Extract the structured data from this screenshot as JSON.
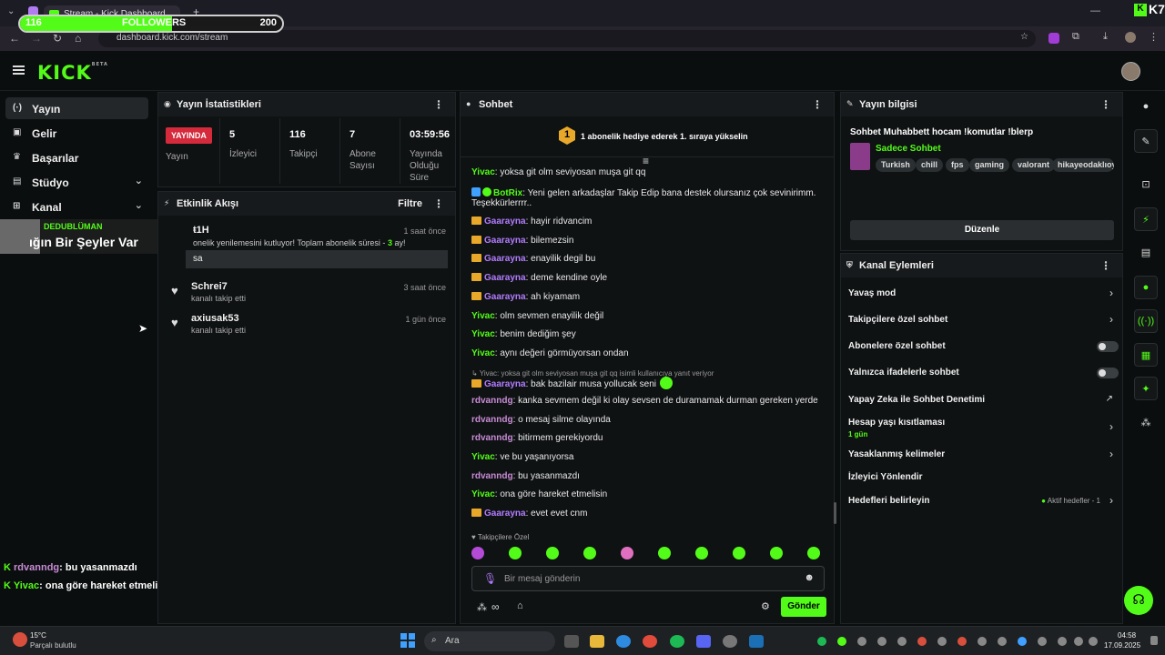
{
  "browser": {
    "tab_title": "Stream - Kick Dashboard",
    "url": "dashboard.kick.com/stream",
    "add_tab": "+",
    "extension_label": "K7"
  },
  "overlay": {
    "followers_current": "116",
    "followers_label": "FOLLOWERS",
    "followers_goal": "200",
    "followers_progress": 0.58,
    "chat": [
      {
        "user": "rdvanndg",
        "text": ": bu yasanmazdı"
      },
      {
        "user": "Yivac",
        "text": ": ona göre hareket etmelisin"
      }
    ],
    "popup_user": "DEDUBLÜMAN",
    "popup_text": "ığın Bir Şeyler Var"
  },
  "header": {
    "logo": "KICK",
    "logo_sup": "BETA"
  },
  "sidebar": {
    "items": [
      {
        "label": "Yayın",
        "icon": "(·)"
      },
      {
        "label": "Gelir",
        "icon": "▣"
      },
      {
        "label": "Başarılar",
        "icon": "♛"
      },
      {
        "label": "Stüdyo",
        "icon": "▤"
      },
      {
        "label": "Kanal",
        "icon": "⊞"
      }
    ]
  },
  "stats": {
    "title": "Yayın İstatistikleri",
    "live_badge": "YAYINDA",
    "live_label": "Yayın",
    "items": [
      {
        "value": "5",
        "label": "İzleyici"
      },
      {
        "value": "116",
        "label": "Takipçi"
      },
      {
        "value": "7",
        "label": "Abone Sayısı"
      },
      {
        "value": "03:59:56",
        "label": "Yayında Olduğu Süre"
      }
    ]
  },
  "activity": {
    "title": "Etkinlik Akışı",
    "filter": "Filtre",
    "first": {
      "user": "ŧ1H",
      "text_prefix": "onelik yenilemesini kutluyor! Toplam abonelik süresi - ",
      "months": "3",
      "text_suffix": " ay!",
      "time": "1 saat önce",
      "message": "sa"
    },
    "items": [
      {
        "user": "Schrei7",
        "text": "kanalı takip etti",
        "time": "3 saat önce"
      },
      {
        "user": "axiusak53",
        "text": "kanalı takip etti",
        "time": "1 gün önce"
      }
    ]
  },
  "chat": {
    "title": "Sohbet",
    "gift_rank": "1",
    "gift_text": "1 abonelik hediye ederek 1. sıraya yükselin",
    "messages": [
      {
        "user": "Yivac",
        "color": "green",
        "text": ": yoksa git olm seviyosan muşa git qq"
      },
      {
        "user": "BotRix",
        "color": "green",
        "text": ": Yeni gelen arkadaşlar Takip Edip bana destek olursanız çok sevinirimm."
      },
      {
        "user": "Gaarayna",
        "color": "purple",
        "text": ": hayir ridvancim"
      },
      {
        "user": "Gaarayna",
        "color": "purple",
        "text": ": bilemezsin"
      },
      {
        "user": "Gaarayna",
        "color": "purple",
        "text": ": enayilik degil bu"
      },
      {
        "user": "Gaarayna",
        "color": "purple",
        "text": ": deme kendine oyle"
      },
      {
        "user": "Gaarayna",
        "color": "purple",
        "text": ": ah kiyamam"
      },
      {
        "user": "Yivac",
        "color": "green",
        "text": ": olm sevmen enayilik değil"
      },
      {
        "user": "Yivac",
        "color": "green",
        "text": ": benim dediğim şey"
      },
      {
        "user": "Yivac",
        "color": "green",
        "text": ": aynı değeri görmüyorsan ondan"
      },
      {
        "user": "Gaarayna",
        "color": "purple",
        "text": ": bak bazilair musa yollucak seni"
      },
      {
        "user": "rdvanndg",
        "color": "pink",
        "text": ": kanka sevmem değil ki olay sevsen de duramamak durman gereken yerde"
      },
      {
        "user": "rdvanndg",
        "color": "pink",
        "text": ": o mesaj silme olayında"
      },
      {
        "user": "rdvanndg",
        "color": "pink",
        "text": ": bitirmem gerekiyordu"
      },
      {
        "user": "Yivac",
        "color": "green",
        "text": ": ve bu yaşanıyorsa"
      },
      {
        "user": "rdvanndg",
        "color": "pink",
        "text": ": bu yasanmazdı"
      },
      {
        "user": "Yivac",
        "color": "green",
        "text": ": ona göre hareket etmelisin"
      },
      {
        "user": "Gaarayna",
        "color": "purple",
        "text": ": evet evet cnm"
      }
    ],
    "botrix_cont": "Teşekkürlerrrr..",
    "reply_note": "↳ Yivac: yoksa git olm seviyosan muşa git qq isimli kullanıcıya yanıt veriyor",
    "emote_section": "♥ Takipçilere Özel",
    "input_placeholder": "Bir mesaj gönderin",
    "send": "Gönder"
  },
  "stream_info": {
    "title": "Yayın bilgisi",
    "stream_title": "Sohbet Muhabbett hocam !komutlar !blerp",
    "category": "Sadece Sohbet",
    "tags": [
      "Turkish",
      "chill",
      "fps",
      "gaming",
      "valorant",
      "hikayeodaklıoyu"
    ],
    "edit": "Düzenle"
  },
  "channel_actions": {
    "title": "Kanal Eylemleri",
    "items": [
      {
        "label": "Yavaş mod"
      },
      {
        "label": "Takipçilere özel sohbet"
      },
      {
        "label": "Abonelere özel sohbet"
      },
      {
        "label": "Yalnızca ifadelerle sohbet"
      },
      {
        "label": "Yapay Zeka ile Sohbet Denetimi"
      },
      {
        "label": "Hesap yaşı kısıtlaması",
        "sub": "1 gün"
      },
      {
        "label": "Yasaklanmış kelimeler"
      },
      {
        "label": "İzleyici Yönlendir"
      },
      {
        "label": "Hedefleri belirleyin",
        "status": "Aktif hedefler - 1"
      }
    ]
  },
  "taskbar": {
    "weather_temp": "15°C",
    "weather_text": "Parçalı bulutlu",
    "search": "Ara",
    "time": "04:58",
    "date": "17.09.2025"
  },
  "colors": {
    "brand": "#53fc18",
    "live": "#d42a3c",
    "purple": "#b27cff"
  }
}
